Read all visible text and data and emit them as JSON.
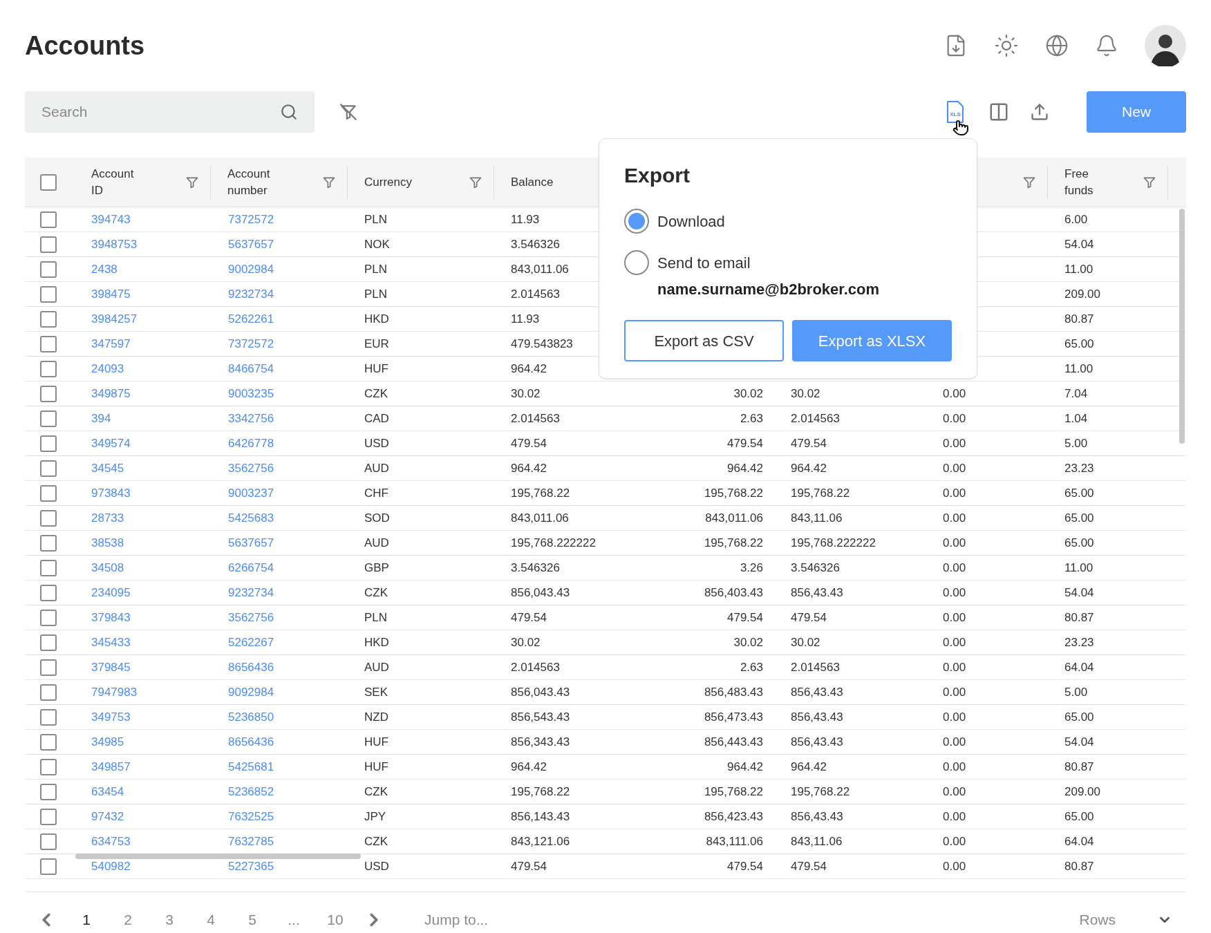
{
  "page": {
    "title": "Accounts"
  },
  "toolbar": {
    "search": {
      "placeholder": "Search"
    },
    "export_icon_text": "XLS",
    "new_button": "New"
  },
  "table": {
    "select_all": {
      "checked": false
    },
    "columns": [
      {
        "label": "Account ID",
        "filter": true
      },
      {
        "label": "Account number",
        "filter": true
      },
      {
        "label": "Currency",
        "filter": true
      },
      {
        "label": "Balance"
      },
      {
        "filter": true
      },
      {
        "label": "Free funds",
        "filter": true
      }
    ],
    "rows": [
      {
        "checked": false,
        "account_id": "394743",
        "account_number": "7372572",
        "currency": "PLN",
        "balance": "11.93",
        "free_funds": "6.00"
      },
      {
        "checked": false,
        "account_id": "3948753",
        "account_number": "5637657",
        "currency": "NOK",
        "balance": "3.546326",
        "free_funds": "54.04"
      },
      {
        "checked": false,
        "account_id": "2438",
        "account_number": "9002984",
        "currency": "PLN",
        "balance": "843,011.06",
        "free_funds": "11.00"
      },
      {
        "checked": false,
        "account_id": "398475",
        "account_number": "9232734",
        "currency": "PLN",
        "balance": "2.014563",
        "free_funds": "209.00"
      },
      {
        "checked": false,
        "account_id": "3984257",
        "account_number": "5262261",
        "currency": "HKD",
        "balance": "11.93",
        "free_funds": "80.87"
      },
      {
        "checked": false,
        "account_id": "347597",
        "account_number": "7372572",
        "currency": "EUR",
        "balance": "479.543823",
        "free_funds": "65.00"
      },
      {
        "checked": false,
        "account_id": "24093",
        "account_number": "8466754",
        "currency": "HUF",
        "balance": "964.42",
        "free_funds": "11.00"
      },
      {
        "checked": false,
        "account_id": "349875",
        "account_number": "9003235",
        "currency": "CZK",
        "balance": "30.02",
        "column_5": "30.02",
        "column_6": "30.02",
        "column_7": "0.00",
        "free_funds": "7.04"
      },
      {
        "checked": false,
        "account_id": "394",
        "account_number": "3342756",
        "currency": "CAD",
        "balance": "2.014563",
        "column_5": "2.63",
        "column_6": "2.014563",
        "column_7": "0.00",
        "free_funds": "1.04"
      },
      {
        "checked": false,
        "account_id": "349574",
        "account_number": "6426778",
        "currency": "USD",
        "balance": "479.54",
        "column_5": "479.54",
        "column_6": "479.54",
        "column_7": "0.00",
        "free_funds": "5.00"
      },
      {
        "checked": false,
        "account_id": "34545",
        "account_number": "3562756",
        "currency": "AUD",
        "balance": "964.42",
        "column_5": "964.42",
        "column_6": "964.42",
        "column_7": "0.00",
        "free_funds": "23.23"
      },
      {
        "checked": false,
        "account_id": "973843",
        "account_number": "9003237",
        "currency": "CHF",
        "balance": "195,768.22",
        "column_5": "195,768.22",
        "column_6": "195,768.22",
        "column_7": "0.00",
        "free_funds": "65.00"
      },
      {
        "checked": false,
        "account_id": "28733",
        "account_number": "5425683",
        "currency": "SOD",
        "balance": "843,011.06",
        "column_5": "843,011.06",
        "column_6": "843,11.06",
        "column_7": "0.00",
        "free_funds": "65.00"
      },
      {
        "checked": false,
        "account_id": "38538",
        "account_number": "5637657",
        "currency": "AUD",
        "balance": "195,768.222222",
        "column_5": "195,768.22",
        "column_6": "195,768.222222",
        "column_7": "0.00",
        "free_funds": "65.00"
      },
      {
        "checked": false,
        "account_id": "34508",
        "account_number": "6266754",
        "currency": "GBP",
        "balance": "3.546326",
        "column_5": "3.26",
        "column_6": "3.546326",
        "column_7": "0.00",
        "free_funds": "11.00"
      },
      {
        "checked": false,
        "account_id": "234095",
        "account_number": "9232734",
        "currency": "CZK",
        "balance": "856,043.43",
        "column_5": "856,403.43",
        "column_6": "856,43.43",
        "column_7": "0.00",
        "free_funds": "54.04"
      },
      {
        "checked": false,
        "account_id": "379843",
        "account_number": "3562756",
        "currency": "PLN",
        "balance": "479.54",
        "column_5": "479.54",
        "column_6": "479.54",
        "column_7": "0.00",
        "free_funds": "80.87"
      },
      {
        "checked": false,
        "account_id": "345433",
        "account_number": "5262267",
        "currency": "HKD",
        "balance": "30.02",
        "column_5": "30.02",
        "column_6": "30.02",
        "column_7": "0.00",
        "free_funds": "23.23"
      },
      {
        "checked": false,
        "account_id": "379845",
        "account_number": "8656436",
        "currency": "AUD",
        "balance": "2.014563",
        "column_5": "2.63",
        "column_6": "2.014563",
        "column_7": "0.00",
        "free_funds": "64.04"
      },
      {
        "checked": false,
        "account_id": "7947983",
        "account_number": "9092984",
        "currency": "SEK",
        "balance": "856,043.43",
        "column_5": "856,483.43",
        "column_6": "856,43.43",
        "column_7": "0.00",
        "free_funds": "5.00"
      },
      {
        "checked": false,
        "account_id": "349753",
        "account_number": "5236850",
        "currency": "NZD",
        "balance": "856,543.43",
        "column_5": "856,473.43",
        "column_6": "856,43.43",
        "column_7": "0.00",
        "free_funds": "65.00"
      },
      {
        "checked": false,
        "account_id": "34985",
        "account_number": "8656436",
        "currency": "HUF",
        "balance": "856,343.43",
        "column_5": "856,443.43",
        "column_6": "856,43.43",
        "column_7": "0.00",
        "free_funds": "54.04"
      },
      {
        "checked": false,
        "account_id": "349857",
        "account_number": "5425681",
        "currency": "HUF",
        "balance": "964.42",
        "column_5": "964.42",
        "column_6": "964.42",
        "column_7": "0.00",
        "free_funds": "80.87"
      },
      {
        "checked": false,
        "account_id": "63454",
        "account_number": "5236852",
        "currency": "CZK",
        "balance": "195,768.22",
        "column_5": "195,768.22",
        "column_6": "195,768.22",
        "column_7": "0.00",
        "free_funds": "209.00"
      },
      {
        "checked": false,
        "account_id": "97432",
        "account_number": "7632525",
        "currency": "JPY",
        "balance": "856,143.43",
        "column_5": "856,423.43",
        "column_6": "856,43.43",
        "column_7": "0.00",
        "free_funds": "65.00"
      },
      {
        "checked": false,
        "account_id": "634753",
        "account_number": "7632785",
        "currency": "CZK",
        "balance": "843,121.06",
        "column_5": "843,111.06",
        "column_6": "843,11.06",
        "column_7": "0.00",
        "free_funds": "64.04"
      },
      {
        "checked": false,
        "account_id": "540982",
        "account_number": "5227365",
        "currency": "USD",
        "balance": "479.54",
        "column_5": "479.54",
        "column_6": "479.54",
        "column_7": "0.00",
        "free_funds": "80.87"
      }
    ]
  },
  "export_popup": {
    "title": "Export",
    "options": [
      {
        "label": "Download",
        "selected": true
      },
      {
        "label": "Send to email",
        "selected": false
      }
    ],
    "email": "name.surname@b2broker.com",
    "buttons": [
      {
        "label": "Export as CSV",
        "kind": "outline"
      },
      {
        "label": "Export as XLSX",
        "kind": "primary"
      }
    ]
  },
  "pagination": {
    "pages": [
      {
        "label": "1",
        "selected": true
      },
      {
        "label": "2",
        "selected": false
      },
      {
        "label": "3",
        "selected": false
      },
      {
        "label": "4",
        "selected": false
      },
      {
        "label": "5",
        "selected": false
      },
      {
        "label": "...",
        "selected": false
      },
      {
        "label": "10",
        "selected": false
      }
    ],
    "jump_placeholder": "Jump to...",
    "rows_label": "Rows"
  }
}
